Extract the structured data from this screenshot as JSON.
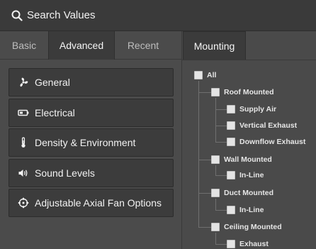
{
  "search": {
    "label": "Search Values",
    "icon": "search-icon"
  },
  "tabs": [
    {
      "label": "Basic",
      "active": false
    },
    {
      "label": "Advanced",
      "active": true
    },
    {
      "label": "Recent",
      "active": false
    }
  ],
  "categories": [
    {
      "label": "General",
      "icon": "fan-icon"
    },
    {
      "label": "Electrical",
      "icon": "battery-icon"
    },
    {
      "label": "Density & Environment",
      "icon": "thermometer-icon"
    },
    {
      "label": "Sound Levels",
      "icon": "speaker-icon"
    },
    {
      "label": "Adjustable Axial Fan Options",
      "icon": "axial-fan-icon"
    }
  ],
  "mounting": {
    "tab_label": "Mounting",
    "tree": {
      "all": "All",
      "roof": {
        "label": "Roof Mounted",
        "children": [
          "Supply Air",
          "Vertical Exhaust",
          "Downflow Exhaust"
        ]
      },
      "wall": {
        "label": "Wall Mounted",
        "children": [
          "In-Line"
        ]
      },
      "duct": {
        "label": "Duct Mounted",
        "children": [
          "In-Line"
        ]
      },
      "ceiling": {
        "label": "Ceiling Mounted",
        "children": [
          "Exhaust"
        ]
      }
    }
  },
  "colors": {
    "background": "#4f4f4f",
    "panel": "#3c3c3c",
    "active_tab": "#3b3b3b",
    "text": "#f2f2f2",
    "tree_line": "#6f6f6f"
  }
}
